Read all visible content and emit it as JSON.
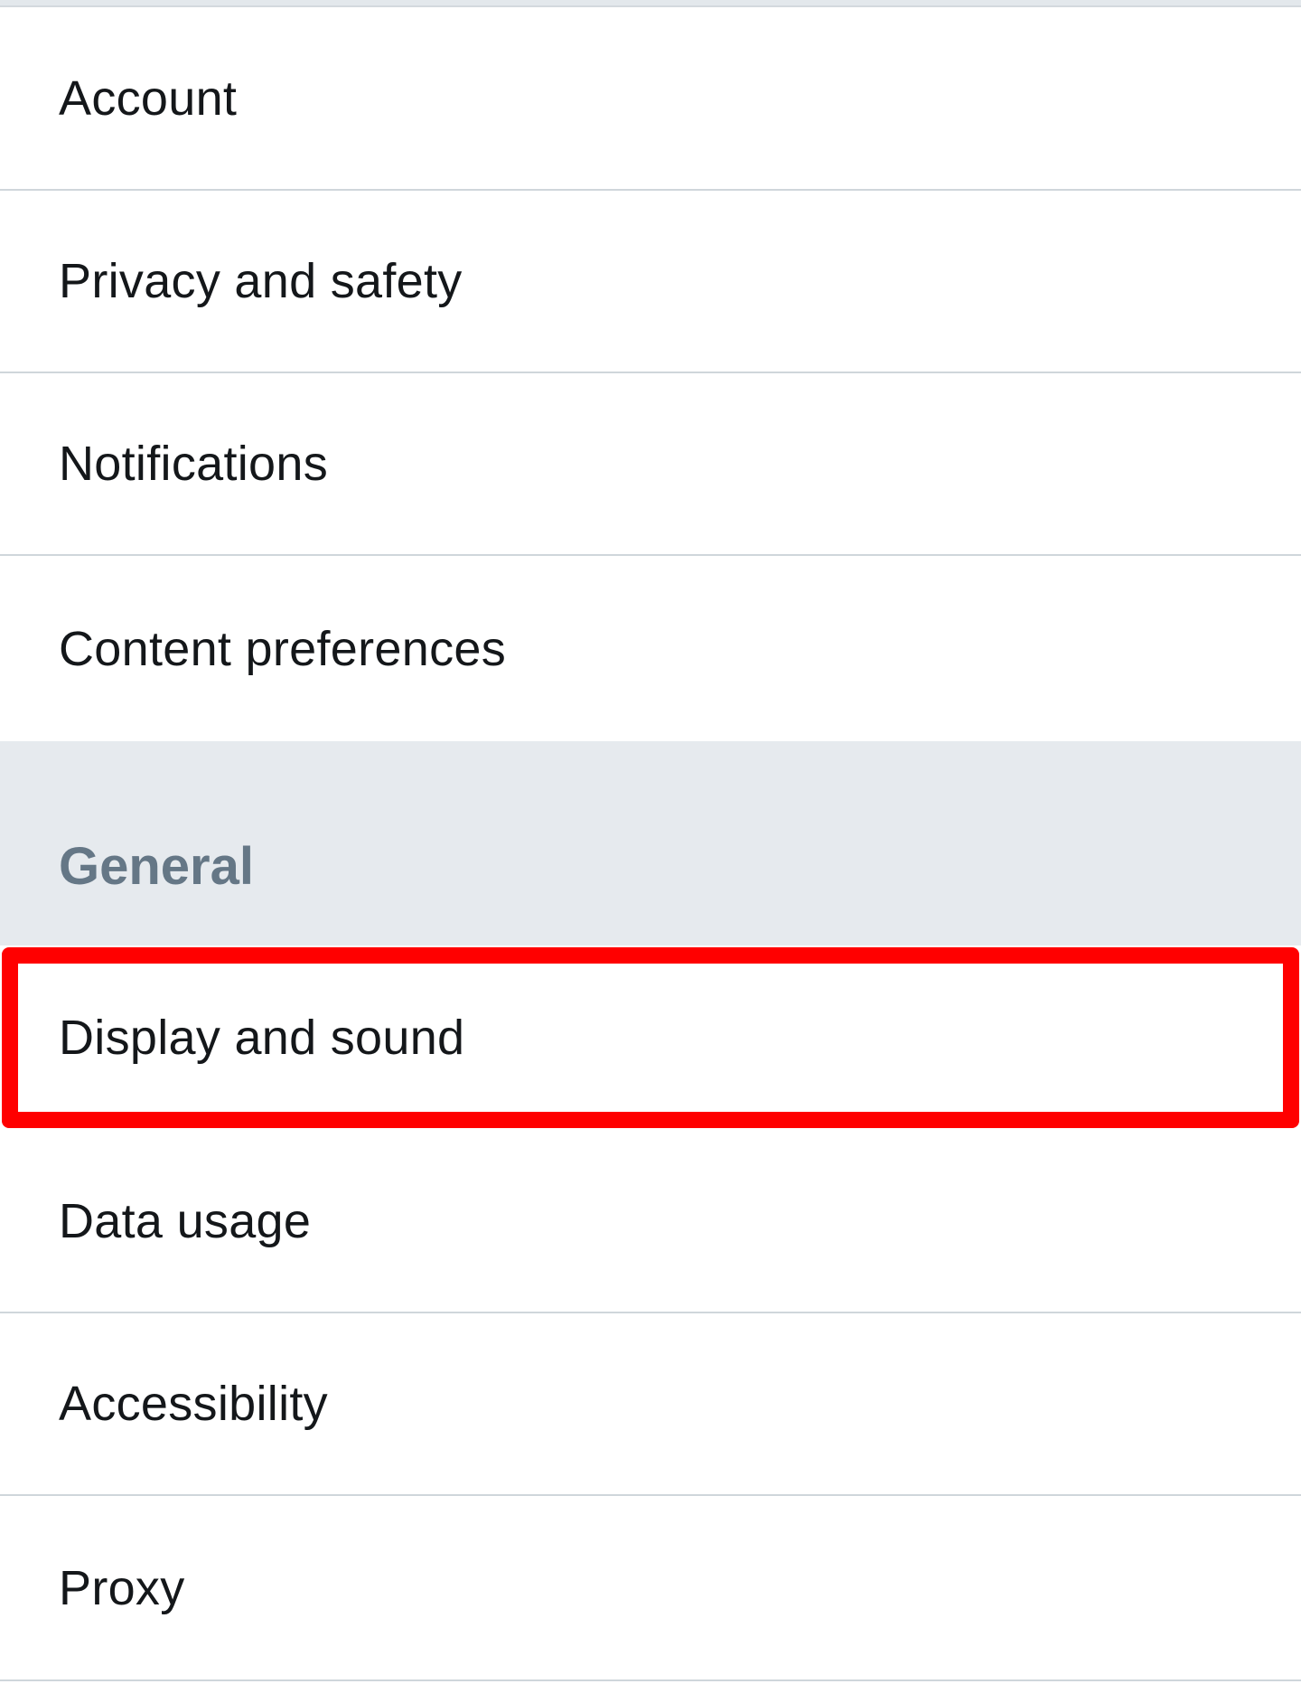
{
  "settings": {
    "items_top": [
      {
        "label": "Account"
      },
      {
        "label": "Privacy and safety"
      },
      {
        "label": "Notifications"
      },
      {
        "label": "Content preferences"
      }
    ],
    "section": {
      "label": "General"
    },
    "items_general": [
      {
        "label": "Display and sound"
      },
      {
        "label": "Data usage"
      },
      {
        "label": "Accessibility"
      },
      {
        "label": "Proxy"
      }
    ]
  },
  "highlight": {
    "target": "Display and sound",
    "color": "#ff0000"
  }
}
